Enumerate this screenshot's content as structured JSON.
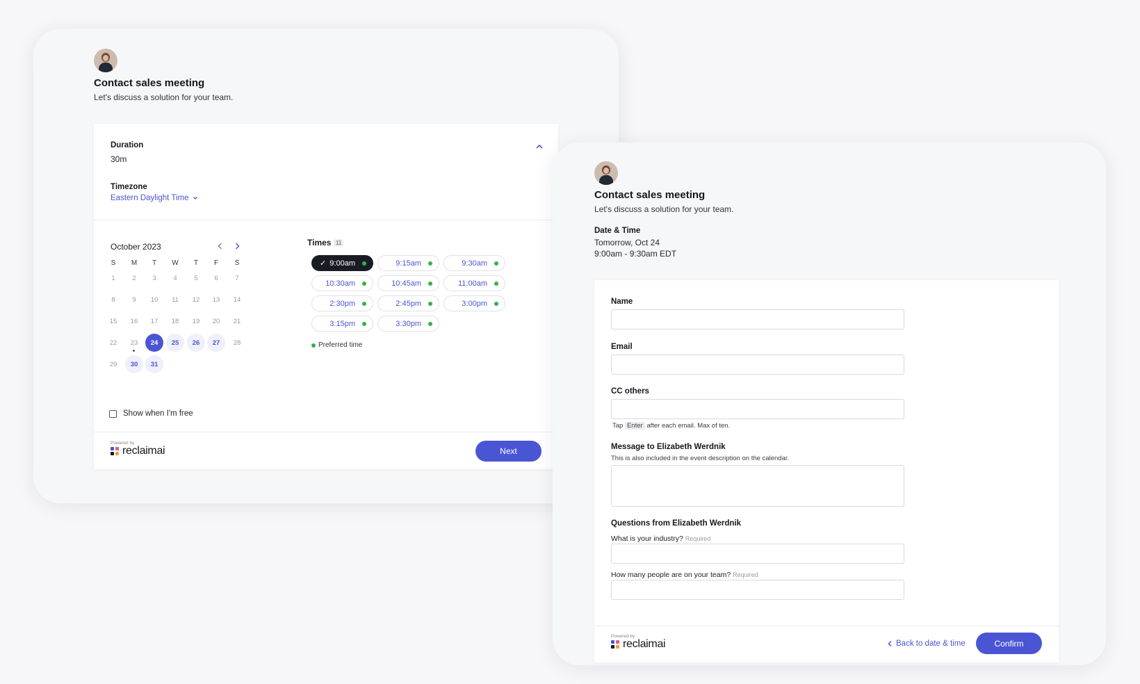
{
  "left": {
    "title": "Contact sales meeting",
    "subtitle": "Let's discuss a solution for your team.",
    "duration_label": "Duration",
    "duration_value": "30m",
    "timezone_label": "Timezone",
    "timezone_value": "Eastern Daylight Time",
    "calendar": {
      "month": "October 2023",
      "weekdays": [
        "S",
        "M",
        "T",
        "W",
        "T",
        "F",
        "S"
      ],
      "selected_day": "24",
      "available_days": [
        "25",
        "26",
        "27",
        "30",
        "31"
      ]
    },
    "times_label": "Times",
    "times_count": "11",
    "slots": [
      "9:00am",
      "9:15am",
      "9:30am",
      "10:30am",
      "10:45am",
      "11:00am",
      "2:30pm",
      "2:45pm",
      "3:00pm",
      "3:15pm",
      "3:30pm"
    ],
    "selected_slot": "9:00am",
    "preferred_legend": "Preferred time",
    "show_free_label": "Show when I'm free",
    "powered_by": "Powered by",
    "brand": "reclaimai",
    "next_label": "Next"
  },
  "right": {
    "title": "Contact sales meeting",
    "subtitle": "Let's discuss a solution for your team.",
    "datetime_label": "Date & Time",
    "date_value": "Tomorrow, Oct 24",
    "time_value": "9:00am - 9:30am EDT",
    "name_label": "Name",
    "email_label": "Email",
    "cc_label": "CC others",
    "cc_hint_pre": "Tap",
    "cc_hint_key": "Enter",
    "cc_hint_post": "after each email. Max of ten.",
    "message_label": "Message to Elizabeth Werdnik",
    "message_hint": "This is also included in the event description on the calendar.",
    "questions_label": "Questions from Elizabeth Werdnik",
    "q1_label": "What is your industry?",
    "q2_label": "How many people are on your team?",
    "required_label": "Required",
    "powered_by": "Powered by",
    "brand": "reclaimai",
    "back_label": "Back to date & time",
    "confirm_label": "Confirm"
  },
  "colors": {
    "accent": "#4a55d4",
    "selected_slot_bg": "#1a1c24",
    "preferred_dot": "#34b24a"
  },
  "icons": [
    "chevron-up-icon",
    "chevron-down-icon",
    "chevron-left-icon",
    "chevron-right-icon",
    "check-icon",
    "reclaim-logo-icon"
  ]
}
